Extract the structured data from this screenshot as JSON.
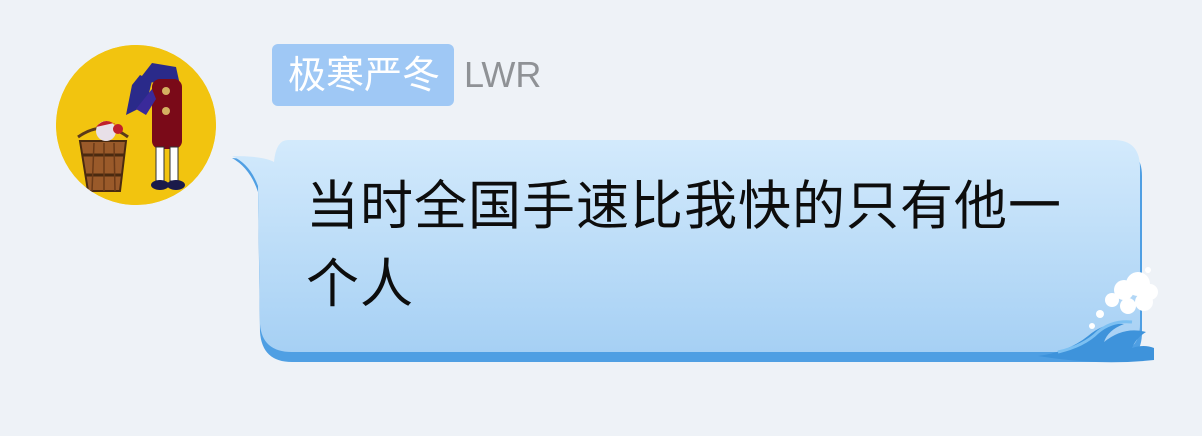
{
  "sender": {
    "avatar_icon": "anime-character-with-bucket-avatar",
    "title_badge": "极寒严冬",
    "name": "LWR"
  },
  "message": {
    "text": "当时全国手速比我快的只有他一个人",
    "bubble_decoration": "ocean-wave-icon"
  },
  "colors": {
    "background": "#eef2f7",
    "badge": "#9fc8f5",
    "bubble_top": "#cce6fb",
    "bubble_bottom": "#a8d2f5",
    "bubble_shadow": "#4f9fe3",
    "avatar_bg": "#f2c40f"
  }
}
